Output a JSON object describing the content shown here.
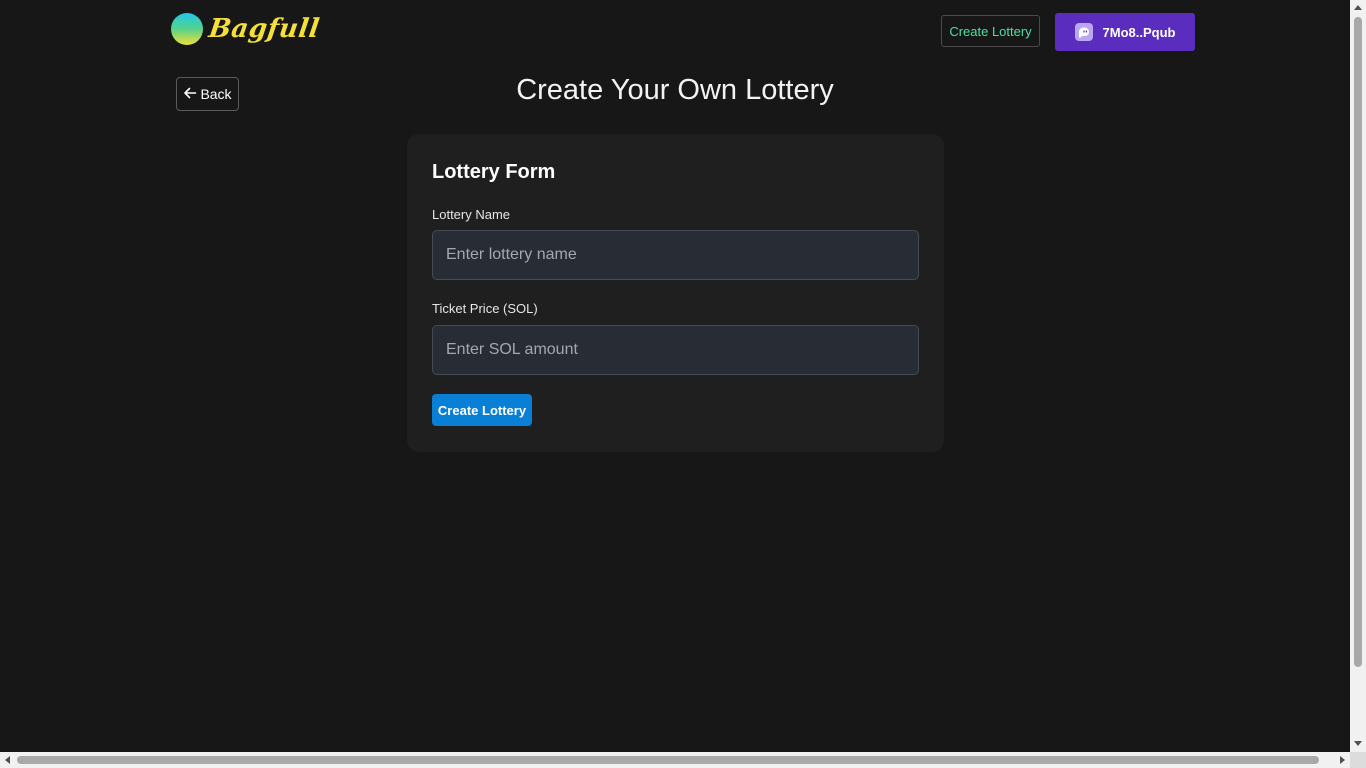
{
  "header": {
    "logo_text": "Bagfull",
    "create_lottery_label": "Create Lottery",
    "wallet_label": "7Mo8..Pqub",
    "wallet_icon": "ghost-icon"
  },
  "nav": {
    "back_label": "Back",
    "back_icon": "arrow-left-icon"
  },
  "page": {
    "title": "Create Your Own Lottery"
  },
  "form": {
    "title": "Lottery Form",
    "name_label": "Lottery Name",
    "name_placeholder": "Enter lottery name",
    "name_value": "",
    "price_label": "Ticket Price (SOL)",
    "price_placeholder": "Enter SOL amount",
    "price_value": "",
    "submit_label": "Create Lottery"
  },
  "colors": {
    "background": "#171717",
    "card": "#1f1f1f",
    "logo_text": "#f5e03a",
    "nav_link": "#4be0a0",
    "wallet_button": "#5b2dbf",
    "submit_button": "#0a7fd6",
    "input_bg": "#272c35"
  }
}
